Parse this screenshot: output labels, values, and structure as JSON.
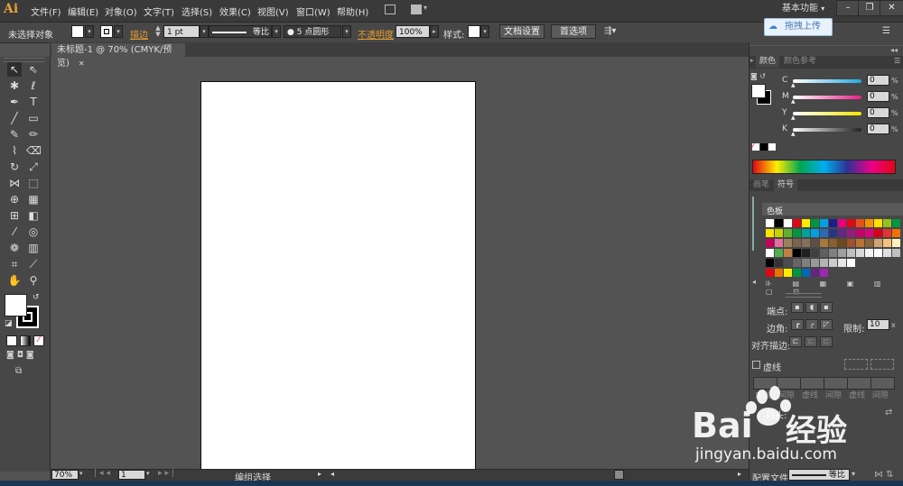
{
  "app": {
    "logo": "Ai",
    "workspace": "基本功能",
    "upload": "拖拽上传"
  },
  "menu": [
    "文件(F)",
    "编辑(E)",
    "对象(O)",
    "文字(T)",
    "选择(S)",
    "效果(C)",
    "视图(V)",
    "窗口(W)",
    "帮助(H)"
  ],
  "control": {
    "no_selection": "未选择对象",
    "stroke_label": "描边",
    "stroke_weight": "1 pt",
    "profile_label": "等比",
    "brush": "5 点圆形",
    "opacity_label": "不透明度",
    "opacity": "100%",
    "style_label": "样式:",
    "doc_setup": "文档设置",
    "prefs": "首选项"
  },
  "document": {
    "tab_title": "未标题-1 @ 70% (CMYK/预览)"
  },
  "status": {
    "zoom": "70%",
    "page": "1",
    "tool": "编组选择"
  },
  "color_panel": {
    "tab_color": "颜色",
    "tab_color_guide": "颜色参考",
    "channels": [
      {
        "label": "C",
        "value": "0",
        "color": "#23a9e1"
      },
      {
        "label": "M",
        "value": "0",
        "color": "#e8208a"
      },
      {
        "label": "Y",
        "value": "0",
        "color": "#f2e600"
      },
      {
        "label": "K",
        "value": "0",
        "color": "#222222"
      }
    ]
  },
  "swatch_panel": {
    "tab_brush": "画笔",
    "tab_symbol": "符号",
    "header": "色板",
    "rows": [
      [
        "#ffffff",
        "#000000",
        "#ffffff",
        "#e30613",
        "#ffed00",
        "#009640",
        "#00a0e3",
        "#1d1d8e",
        "#e6007e",
        "#e30613",
        "#e94e1b",
        "#f39200",
        "#ffde00",
        "#95c11f",
        "#009640"
      ],
      [
        "#f7e600",
        "#c6d300",
        "#60b22e",
        "#009640",
        "#00a19a",
        "#00a0e3",
        "#2b6ab2",
        "#283583",
        "#662483",
        "#951b81",
        "#c8006a",
        "#e2007a",
        "#d9001b",
        "#e5342e",
        "#ee7203"
      ],
      [
        "#c3005b",
        "#e46e9d",
        "#9c7f5b",
        "#7a6450",
        "#85705a",
        "#5d4f43",
        "#a47a3c",
        "#8b5e2b",
        "#6c4a1f",
        "#a0522d",
        "#b87333",
        "#8c6239",
        "#d4a373",
        "#f4c27a",
        "#fff0c0"
      ],
      [
        "#ffffff",
        "#4caf50",
        "#c08040",
        "#000000",
        "#202020",
        "#404040",
        "#606060",
        "#808080",
        "#a0a0a0",
        "#bfbfbf",
        "#d9d9d9",
        "#f2f2f2",
        "#ffffff",
        "#e0e0e0",
        "#c0c0c0"
      ],
      [
        "#000000",
        "#333333",
        "#4d4d4d",
        "#666666",
        "#808080",
        "#999999",
        "#b3b3b3",
        "#cccccc",
        "#e6e6e6",
        "#ffffff"
      ],
      [
        "#e30613",
        "#ee7203",
        "#ffed00",
        "#009640",
        "#0069b4",
        "#662483",
        "#9c27b0"
      ]
    ]
  },
  "stroke_panel": {
    "cap_label": "端点:",
    "corner_label": "边角:",
    "limit_label": "限制:",
    "limit_value": "10",
    "align_label": "对齐描边:",
    "dashed_label": "虚线",
    "dash_labels": [
      "虚线",
      "间隙",
      "虚线",
      "间隙",
      "虚线",
      "间隙"
    ],
    "arrow_label": "箭头:",
    "profile_label": "配置文件:",
    "profile_value": "等比"
  },
  "watermark": {
    "brand_left": "Bai",
    "brand_right": "经验",
    "url": "jingyan.baidu.com"
  }
}
